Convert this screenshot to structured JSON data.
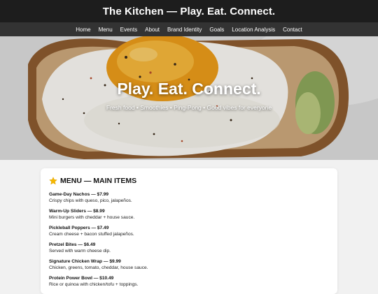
{
  "site": {
    "title": "The Kitchen — Play. Eat. Connect."
  },
  "nav": {
    "items": [
      {
        "label": "Home",
        "name": "nav-home"
      },
      {
        "label": "Menu",
        "name": "nav-menu"
      },
      {
        "label": "Events",
        "name": "nav-events"
      },
      {
        "label": "About",
        "name": "nav-about"
      },
      {
        "label": "Brand Identity",
        "name": "nav-brand-identity"
      },
      {
        "label": "Goals",
        "name": "nav-goals"
      },
      {
        "label": "Location Analysis",
        "name": "nav-location-analysis"
      },
      {
        "label": "Contact",
        "name": "nav-contact"
      }
    ]
  },
  "hero": {
    "heading": "Play. Eat. Connect.",
    "subheading": "Fresh food • Smoothies • Ping-Pong • Good vibes for everyone",
    "image": "egg-on-toast-photo"
  },
  "menu": {
    "icon": "star-icon",
    "heading": "MENU — MAIN ITEMS",
    "items": [
      {
        "title": "Game-Day Nachos — $7.99",
        "desc": "Crispy chips with queso, pico, jalapeños."
      },
      {
        "title": "Warm-Up Sliders — $8.99",
        "desc": "Mini burgers with cheddar + house sauce."
      },
      {
        "title": "Pickleball Poppers — $7.49",
        "desc": "Cream cheese + bacon stuffed jalapeños."
      },
      {
        "title": "Pretzel Bites — $6.49",
        "desc": "Served with warm cheese dip."
      },
      {
        "title": "Signature Chicken Wrap — $9.99",
        "desc": "Chicken, greens, tomato, cheddar, house sauce."
      },
      {
        "title": "Protein Power Bowl — $10.49",
        "desc": "Rice or quinoa with chicken/tofu + toppings."
      }
    ]
  },
  "colors": {
    "header": "#1d1d1d",
    "nav": "#333333",
    "page_bg": "#f1f1f1",
    "card_bg": "#ffffff",
    "star": "#f5b800"
  }
}
